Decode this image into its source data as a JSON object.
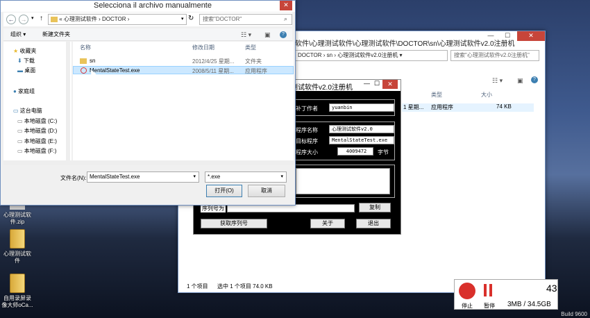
{
  "desktop": {
    "icons": [
      {
        "label": "心理测试软\n件.zip"
      },
      {
        "label": "心理测试软件"
      },
      {
        "label": "自用录屏录像大师oCa..."
      }
    ],
    "corner_text": "Build 9600"
  },
  "explorer": {
    "path": [
      "DOCTOR",
      "sn",
      "心理测试软件v2.0注册机"
    ],
    "title": "软件\\心理测试软件\\心理测试软件\\DOCTOR\\sn\\心理测试软件v2.0注册机",
    "search_placeholder": "搜索\"心理测试软件v2.0注册机\"",
    "col_type": "类型",
    "col_size": "大小",
    "row": {
      "date": "1 星期...",
      "type": "应用程序",
      "size": "74 KB"
    },
    "status_items": "1 个项目",
    "status_selected": "选中 1 个项目 74.0 KB"
  },
  "keygen": {
    "title": "心理测试软件v2.0注册机",
    "patch_author_label": "补丁作者",
    "patch_author": "yuanbin",
    "program_name_label": "程序名称",
    "program_name": "心理测试软件v2.0",
    "target_label": "目标程序",
    "target": "MentalStateTest.exe",
    "size_label": "程序大小",
    "size": "4009472",
    "size_unit": "字节",
    "serial_label": "序列号为",
    "serial_value": "",
    "copy": "复制",
    "get_serial": "获取序列号",
    "about": "关于",
    "exit": "退出"
  },
  "dialog": {
    "title": "Selecciona il archivo manualmente",
    "breadcrumb_sep": "«",
    "crumbs": [
      "心理测试软件",
      "DOCTOR"
    ],
    "search_placeholder": "搜索\"DOCTOR\"",
    "organize": "组织 ▾",
    "new_folder": "新建文件夹",
    "sidebar": [
      {
        "label": "收藏夹",
        "icon": "star-icon"
      },
      {
        "label": "下载",
        "icon": "download-icon"
      },
      {
        "label": "桌面",
        "icon": "desktop-icon"
      },
      {
        "label": "家庭组",
        "icon": "homegroup-icon"
      },
      {
        "label": "这台电脑",
        "icon": "computer-icon"
      },
      {
        "label": "本地磁盘 (C:)",
        "icon": "drive-icon"
      },
      {
        "label": "本地磁盘 (D:)",
        "icon": "drive-icon"
      },
      {
        "label": "本地磁盘 (E:)",
        "icon": "drive-icon"
      },
      {
        "label": "本地磁盘 (F:)",
        "icon": "drive-icon"
      }
    ],
    "columns": {
      "name": "名称",
      "date": "修改日期",
      "type": "类型"
    },
    "files": [
      {
        "name": "sn",
        "date": "2012/4/25 星期...",
        "type": "文件夹"
      },
      {
        "name": "MentalStateTest.exe",
        "date": "2008/5/11 星期...",
        "type": "应用程序"
      }
    ],
    "filename_label": "文件名(N):",
    "filename_value": "MentalStateTest.exe",
    "filter_value": "*.exe",
    "open": "打开(O)",
    "cancel": "取消"
  },
  "recorder": {
    "stop": "停止",
    "pause": "暂停",
    "size": "3MB / 34.5GB",
    "timer_digits": "43"
  },
  "colors": {
    "accent": "#3c7fb1",
    "selected_row": "#cce8ff",
    "close_red": "#c7453a",
    "rec_red": "#d9302b"
  }
}
